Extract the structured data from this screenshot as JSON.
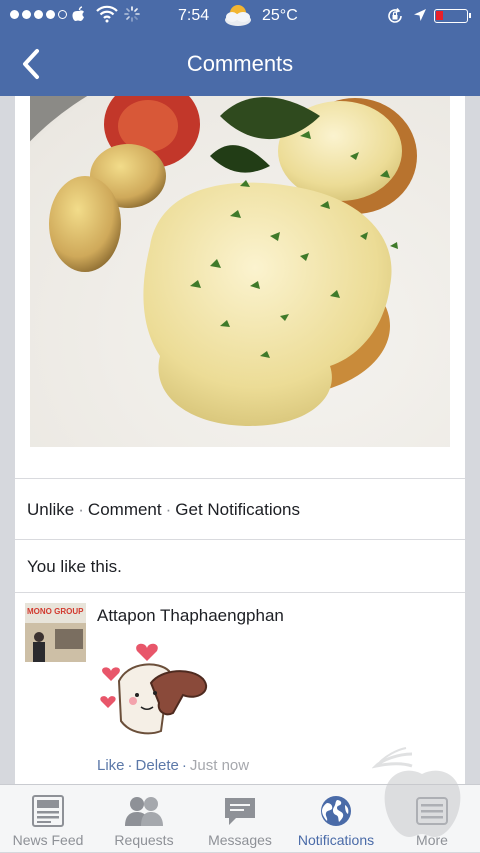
{
  "status_bar": {
    "time": "7:54",
    "temperature": "25°C",
    "battery_color": "#e8202a"
  },
  "nav": {
    "title": "Comments",
    "back_icon": "chevron-left-icon"
  },
  "post": {
    "actions": {
      "unlike": "Unlike",
      "comment": "Comment",
      "get_notifications": "Get Notifications",
      "separator": "·"
    },
    "likes_text": "You like this.",
    "comment": {
      "author": "Attapon Thaphaengphan",
      "avatar_text": "MONO GROUP",
      "like": "Like",
      "delete": "Delete",
      "time": "Just now"
    }
  },
  "tabs": [
    {
      "label": "News Feed",
      "icon": "news-feed-icon",
      "active": false
    },
    {
      "label": "Requests",
      "icon": "requests-icon",
      "active": false
    },
    {
      "label": "Messages",
      "icon": "messages-icon",
      "active": false
    },
    {
      "label": "Notifications",
      "icon": "notifications-globe-icon",
      "active": true
    },
    {
      "label": "More",
      "icon": "more-icon",
      "active": false
    }
  ],
  "colors": {
    "brand": "#4a6ba8",
    "link": "#5b78a8"
  }
}
